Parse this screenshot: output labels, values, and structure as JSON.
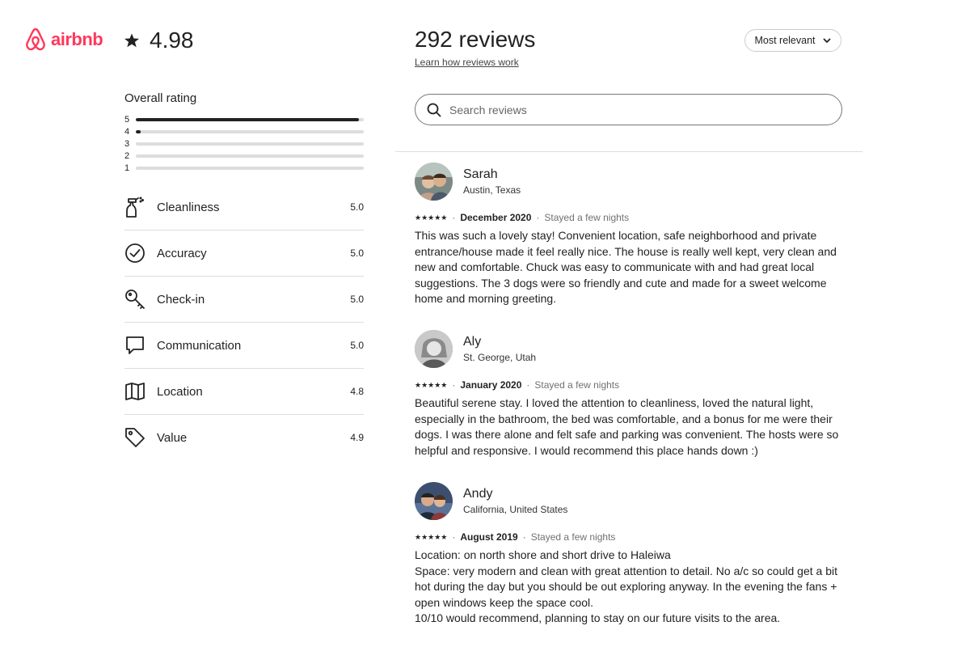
{
  "brand": {
    "name": "airbnb",
    "color": "#ff385c",
    "icon": "airbnb-logo-icon"
  },
  "overall": {
    "score": "4.98",
    "icon": "star-icon"
  },
  "rating_breakdown": {
    "title": "Overall rating",
    "rows": [
      {
        "label": "5",
        "fraction": 0.98
      },
      {
        "label": "4",
        "fraction": 0.02
      },
      {
        "label": "3",
        "fraction": 0
      },
      {
        "label": "2",
        "fraction": 0
      },
      {
        "label": "1",
        "fraction": 0
      }
    ]
  },
  "categories": [
    {
      "name": "Cleanliness",
      "value": "5.0",
      "icon": "spray-bottle-icon"
    },
    {
      "name": "Accuracy",
      "value": "5.0",
      "icon": "check-circle-icon"
    },
    {
      "name": "Check-in",
      "value": "5.0",
      "icon": "key-icon"
    },
    {
      "name": "Communication",
      "value": "5.0",
      "icon": "chat-bubble-icon"
    },
    {
      "name": "Location",
      "value": "4.8",
      "icon": "map-icon"
    },
    {
      "name": "Value",
      "value": "4.9",
      "icon": "tag-icon"
    }
  ],
  "reviews_header": {
    "title": "292 reviews",
    "learn_link": "Learn how reviews work",
    "sort_label": "Most relevant"
  },
  "search": {
    "placeholder": "Search reviews"
  },
  "reviews": [
    {
      "name": "Sarah",
      "location": "Austin, Texas",
      "stars": "★★★★★",
      "date": "December 2020",
      "separator": "·",
      "stay": "Stayed a few nights",
      "text": "This was such a lovely stay! Convenient location, safe neighborhood and private entrance/house made it feel really nice. The house is really well kept, very clean and new and comfortable. Chuck was easy to communicate with and had great local suggestions. The 3 dogs were so friendly and cute and made for a sweet welcome home and morning greeting."
    },
    {
      "name": "Aly",
      "location": "St. George, Utah",
      "stars": "★★★★★",
      "date": "January 2020",
      "separator": "·",
      "stay": "Stayed a few nights",
      "text": "Beautiful serene stay. I loved the attention to cleanliness, loved the natural light, especially in the bathroom, the bed was comfortable, and a bonus for me were their dogs. I was there alone and felt safe and parking was convenient. The hosts were so helpful and responsive. I would recommend this place hands down :)"
    },
    {
      "name": "Andy",
      "location": "California, United States",
      "stars": "★★★★★",
      "date": "August 2019",
      "separator": "·",
      "stay": "Stayed a few nights",
      "text": "Location:  on north shore and short drive to Haleiwa\nSpace: very modern and clean with great attention to detail. No a/c so could get a bit hot during the day but you should be out exploring anyway. In the evening the fans + open windows keep the space cool.\n10/10 would recommend, planning to stay on our future visits to the area."
    }
  ]
}
